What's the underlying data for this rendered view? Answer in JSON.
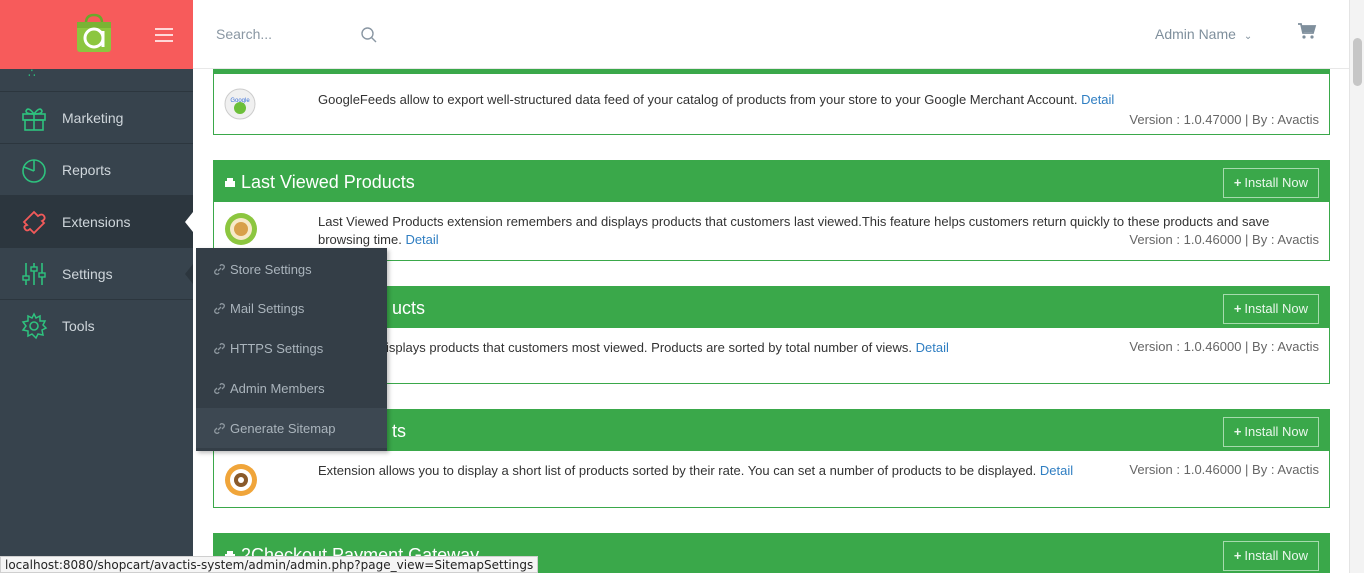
{
  "header": {
    "search_placeholder": "Search...",
    "admin_name": "Admin Name"
  },
  "sidebar": {
    "items": [
      {
        "label": "Marketing",
        "icon": "gift-icon"
      },
      {
        "label": "Reports",
        "icon": "pie-chart-icon"
      },
      {
        "label": "Extensions",
        "icon": "puzzle-icon"
      },
      {
        "label": "Settings",
        "icon": "sliders-icon"
      },
      {
        "label": "Tools",
        "icon": "gear-icon"
      }
    ]
  },
  "submenu": {
    "items": [
      {
        "label": "Store Settings"
      },
      {
        "label": "Mail Settings"
      },
      {
        "label": "HTTPS Settings"
      },
      {
        "label": "Admin Members"
      },
      {
        "label": "Generate Sitemap"
      }
    ]
  },
  "extensions": [
    {
      "title": "",
      "description": "GoogleFeeds allow to export well-structured data feed of your catalog of products from your store to your Google Merchant Account.",
      "detail": "Detail",
      "version": "Version : 1.0.47000 | By : Avactis"
    },
    {
      "title": "Last Viewed Products",
      "install": "Install Now",
      "description_1": "Last Viewed Products extension remembers and displays products that customers last viewed.This feature helps customers return quickly to these products and save",
      "description_2": "browsing time.",
      "detail": "Detail",
      "version": "Version : 1.0.46000 | By : Avactis"
    },
    {
      "title": "ucts",
      "install": "Install Now",
      "description": "isplays products that customers most viewed. Products are sorted by total number of views.",
      "detail": "Detail",
      "version": "Version : 1.0.46000 | By : Avactis"
    },
    {
      "title": "ts",
      "install": "Install Now",
      "description": "Extension allows you to display a short list of products sorted by their rate. You can set a number of products to be displayed.",
      "detail": "Detail",
      "version": "Version : 1.0.46000 | By : Avactis"
    },
    {
      "title": "2Checkout Payment Gateway",
      "install": "Install Now"
    }
  ],
  "statusbar": {
    "url": "localhost:8080/shopcart/avactis-system/admin/admin.php?page_view=SitemapSettings"
  },
  "colors": {
    "brand": "#f75b5b",
    "sidebar": "#37434d",
    "accent_green": "#3aa84a",
    "link": "#2f7ec2"
  }
}
